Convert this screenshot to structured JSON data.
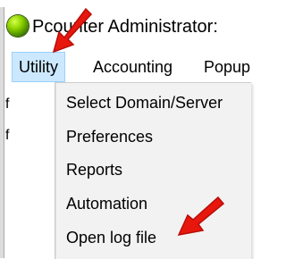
{
  "window": {
    "title": "Pcounter Administrator:",
    "icon": "green-orb-icon"
  },
  "menubar": {
    "items": [
      {
        "label": "Utility",
        "active": true
      },
      {
        "label": "Accounting"
      },
      {
        "label": "Popup"
      }
    ]
  },
  "left_fragment": {
    "chars": [
      "f",
      "f"
    ]
  },
  "utility_menu": {
    "items": [
      {
        "label": "Select Domain/Server"
      },
      {
        "label": "Preferences"
      },
      {
        "label": "Reports"
      },
      {
        "label": "Automation"
      },
      {
        "label": "Open log file"
      }
    ]
  },
  "annotations": {
    "arrow_color": "#e8170e"
  },
  "colors": {
    "menu_active_bg": "#cce8ff",
    "dropdown_bg": "#f2f2f2"
  }
}
